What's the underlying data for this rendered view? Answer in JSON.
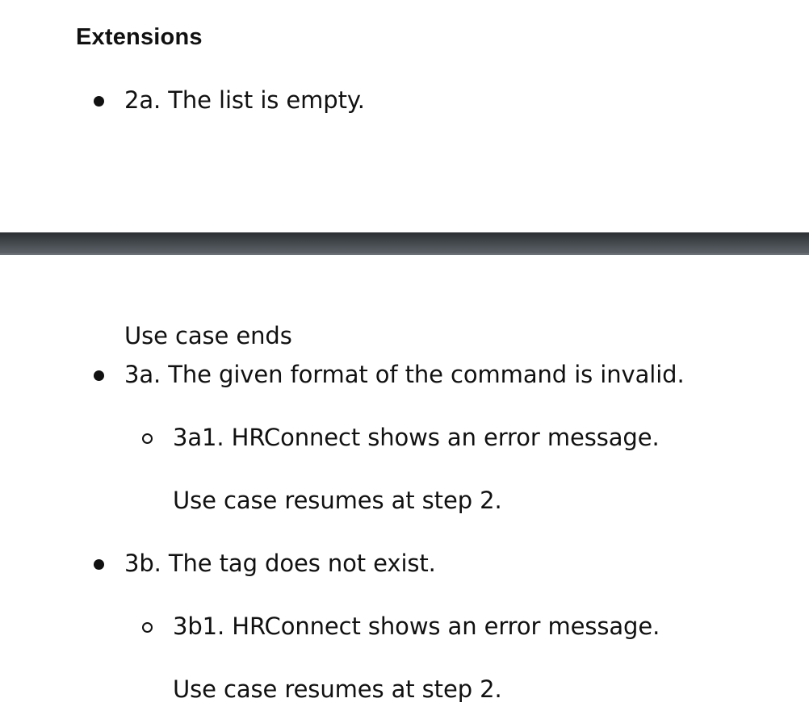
{
  "section": {
    "heading": "Extensions"
  },
  "top_items": [
    {
      "text": "2a. The list is empty."
    }
  ],
  "continued": {
    "trailing_text": "Use case ends",
    "items": [
      {
        "text": "3a. The given format of the command is invalid.",
        "sub": {
          "text": "3a1. HRConnect shows an error message.",
          "note": "Use case resumes at step 2."
        }
      },
      {
        "text": "3b. The tag does not exist.",
        "sub": {
          "text": "3b1. HRConnect shows an error message.",
          "note": "Use case resumes at step 2."
        }
      }
    ]
  }
}
